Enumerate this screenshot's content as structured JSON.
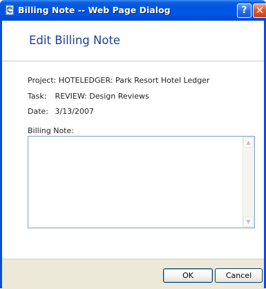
{
  "window": {
    "title": "Billing Note -- Web Page Dialog",
    "help_label": "?",
    "close_label": "✕"
  },
  "header": {
    "heading": "Edit Billing Note"
  },
  "details": {
    "project_label": "Project:",
    "project_value": "HOTELEDGER: Park Resort Hotel Ledger",
    "task_label": "Task:",
    "task_value": "REVIEW: Design Reviews",
    "date_label": "Date:",
    "date_value": "3/13/2007"
  },
  "note": {
    "label": "Billing Note:",
    "value": ""
  },
  "footer": {
    "ok_label": "OK",
    "cancel_label": "Cancel"
  },
  "colors": {
    "titlebar": "#0054e3",
    "heading": "#1b3f9c",
    "footer_bg": "#ece9d8",
    "close_button": "#e2582a"
  }
}
